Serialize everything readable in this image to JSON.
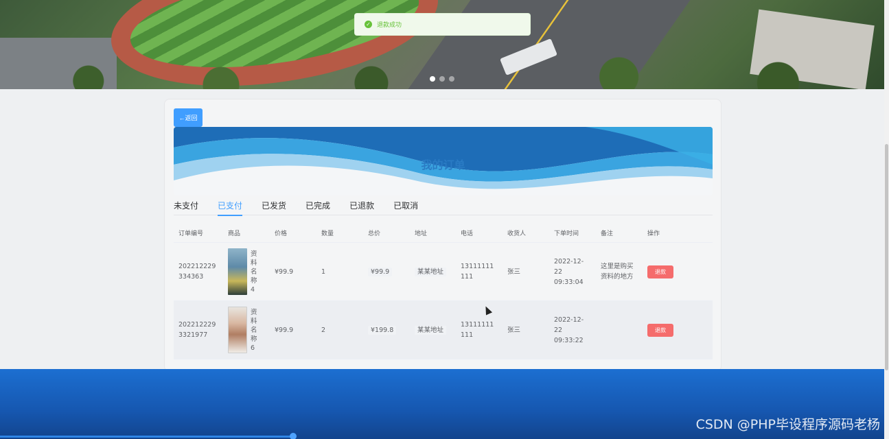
{
  "toast": {
    "message": "退款成功"
  },
  "card": {
    "back_label": "←返回",
    "title": "我的订单"
  },
  "tabs": [
    {
      "label": "未支付"
    },
    {
      "label": "已支付"
    },
    {
      "label": "已发货"
    },
    {
      "label": "已完成"
    },
    {
      "label": "已退款"
    },
    {
      "label": "已取消"
    }
  ],
  "active_tab": "已支付",
  "table": {
    "headers": [
      "订单编号",
      "商品",
      "价格",
      "数量",
      "总价",
      "地址",
      "电话",
      "收货人",
      "下单时间",
      "备注",
      "操作"
    ],
    "rows": [
      {
        "order_no": "202212229334363",
        "goods": "资料名称4",
        "price": "¥99.9",
        "qty": "1",
        "total": "¥99.9",
        "address": "某某地址",
        "phone": "13111111111",
        "receiver": "张三",
        "time": "2022-12-22 09:33:04",
        "note": "这里是购买资料的地方",
        "action": "退款"
      },
      {
        "order_no": "2022122293321977",
        "goods": "资料名称6",
        "price": "¥99.9",
        "qty": "2",
        "total": "¥199.8",
        "address": "某某地址",
        "phone": "13111111111",
        "receiver": "张三",
        "time": "2022-12-22 09:33:22",
        "note": "",
        "action": "退款"
      }
    ]
  },
  "footer": {
    "watermark": "CSDN @PHP毕设程序源码老杨"
  },
  "colors": {
    "primary": "#409eff",
    "danger": "#f56c6c",
    "success": "#67c23a",
    "footer": "#1c6fd1"
  },
  "icons": {
    "toast": "check-circle-icon",
    "back": "arrow-left-icon"
  }
}
